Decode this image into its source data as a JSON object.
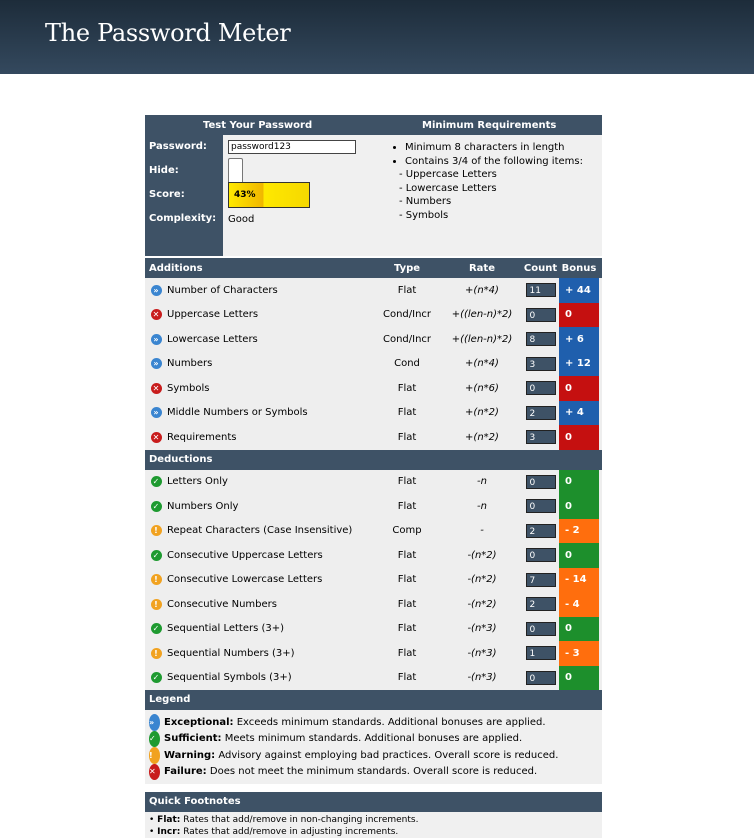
{
  "banner": {
    "title": "The Password Meter"
  },
  "test": {
    "header": "Test Your Password",
    "password_label": "Password:",
    "password_value": "password123",
    "hide_label": "Hide:",
    "score_label": "Score:",
    "score_value": "43%",
    "score_fraction": 0.43,
    "complexity_label": "Complexity:",
    "complexity_value": "Good"
  },
  "requirements": {
    "header": "Minimum Requirements",
    "items": [
      "Minimum 8 characters in length",
      "Contains 3/4 of the following items:"
    ],
    "sub_items": [
      "- Uppercase Letters",
      "- Lowercase Letters",
      "- Numbers",
      "- Symbols"
    ]
  },
  "columns": {
    "additions": "Additions",
    "type": "Type",
    "rate": "Rate",
    "count": "Count",
    "bonus": "Bonus"
  },
  "additions": [
    {
      "status": "exceptional",
      "icon": "exceptional-icon",
      "name": "Number of Characters",
      "type": "Flat",
      "rate": "+(n*4)",
      "count": "11",
      "bonus": "+ 44"
    },
    {
      "status": "failure",
      "icon": "failure-icon",
      "name": "Uppercase Letters",
      "type": "Cond/Incr",
      "rate": "+((len-n)*2)",
      "count": "0",
      "bonus": "0"
    },
    {
      "status": "exceptional",
      "icon": "exceptional-icon",
      "name": "Lowercase Letters",
      "type": "Cond/Incr",
      "rate": "+((len-n)*2)",
      "count": "8",
      "bonus": "+ 6"
    },
    {
      "status": "exceptional",
      "icon": "exceptional-icon",
      "name": "Numbers",
      "type": "Cond",
      "rate": "+(n*4)",
      "count": "3",
      "bonus": "+ 12"
    },
    {
      "status": "failure",
      "icon": "failure-icon",
      "name": "Symbols",
      "type": "Flat",
      "rate": "+(n*6)",
      "count": "0",
      "bonus": "0"
    },
    {
      "status": "exceptional",
      "icon": "exceptional-icon",
      "name": "Middle Numbers or Symbols",
      "type": "Flat",
      "rate": "+(n*2)",
      "count": "2",
      "bonus": "+ 4"
    },
    {
      "status": "failure",
      "icon": "failure-icon",
      "name": "Requirements",
      "type": "Flat",
      "rate": "+(n*2)",
      "count": "3",
      "bonus": "0"
    }
  ],
  "deductions_header": "Deductions",
  "deductions": [
    {
      "status": "sufficient",
      "icon": "sufficient-icon",
      "name": "Letters Only",
      "type": "Flat",
      "rate": "-n",
      "count": "0",
      "bonus": "0"
    },
    {
      "status": "sufficient",
      "icon": "sufficient-icon",
      "name": "Numbers Only",
      "type": "Flat",
      "rate": "-n",
      "count": "0",
      "bonus": "0"
    },
    {
      "status": "warning",
      "icon": "warning-icon",
      "name": "Repeat Characters (Case Insensitive)",
      "type": "Comp",
      "rate": "-",
      "count": "2",
      "bonus": "- 2"
    },
    {
      "status": "sufficient",
      "icon": "sufficient-icon",
      "name": "Consecutive Uppercase Letters",
      "type": "Flat",
      "rate": "-(n*2)",
      "count": "0",
      "bonus": "0"
    },
    {
      "status": "warning",
      "icon": "warning-icon",
      "name": "Consecutive Lowercase Letters",
      "type": "Flat",
      "rate": "-(n*2)",
      "count": "7",
      "bonus": "- 14"
    },
    {
      "status": "warning",
      "icon": "warning-icon",
      "name": "Consecutive Numbers",
      "type": "Flat",
      "rate": "-(n*2)",
      "count": "2",
      "bonus": "- 4"
    },
    {
      "status": "sufficient",
      "icon": "sufficient-icon",
      "name": "Sequential Letters (3+)",
      "type": "Flat",
      "rate": "-(n*3)",
      "count": "0",
      "bonus": "0"
    },
    {
      "status": "warning",
      "icon": "warning-icon",
      "name": "Sequential Numbers (3+)",
      "type": "Flat",
      "rate": "-(n*3)",
      "count": "1",
      "bonus": "- 3"
    },
    {
      "status": "sufficient",
      "icon": "sufficient-icon",
      "name": "Sequential Symbols (3+)",
      "type": "Flat",
      "rate": "-(n*3)",
      "count": "0",
      "bonus": "0"
    }
  ],
  "legend": {
    "header": "Legend",
    "items": [
      {
        "status": "exceptional",
        "icon": "exceptional-icon",
        "term": "Exceptional:",
        "text": "Exceeds minimum standards. Additional bonuses are applied."
      },
      {
        "status": "sufficient",
        "icon": "sufficient-icon",
        "term": "Sufficient:",
        "text": "Meets minimum standards. Additional bonuses are applied."
      },
      {
        "status": "warning",
        "icon": "warning-icon",
        "term": "Warning:",
        "text": "Advisory against employing bad practices. Overall score is reduced."
      },
      {
        "status": "failure",
        "icon": "failure-icon",
        "term": "Failure:",
        "text": "Does not meet the minimum standards. Overall score is reduced."
      }
    ]
  },
  "footnotes": {
    "header": "Quick Footnotes",
    "items": [
      {
        "term": "Flat:",
        "text": "Rates that add/remove in non-changing increments."
      },
      {
        "term": "Incr:",
        "text": "Rates that add/remove in adjusting increments."
      }
    ]
  },
  "colors": {
    "exceptional": "#1f5fad",
    "failure": "#c51010",
    "sufficient": "#1d8f2c",
    "warning": "#ff6e0d",
    "header": "#3e5266"
  }
}
